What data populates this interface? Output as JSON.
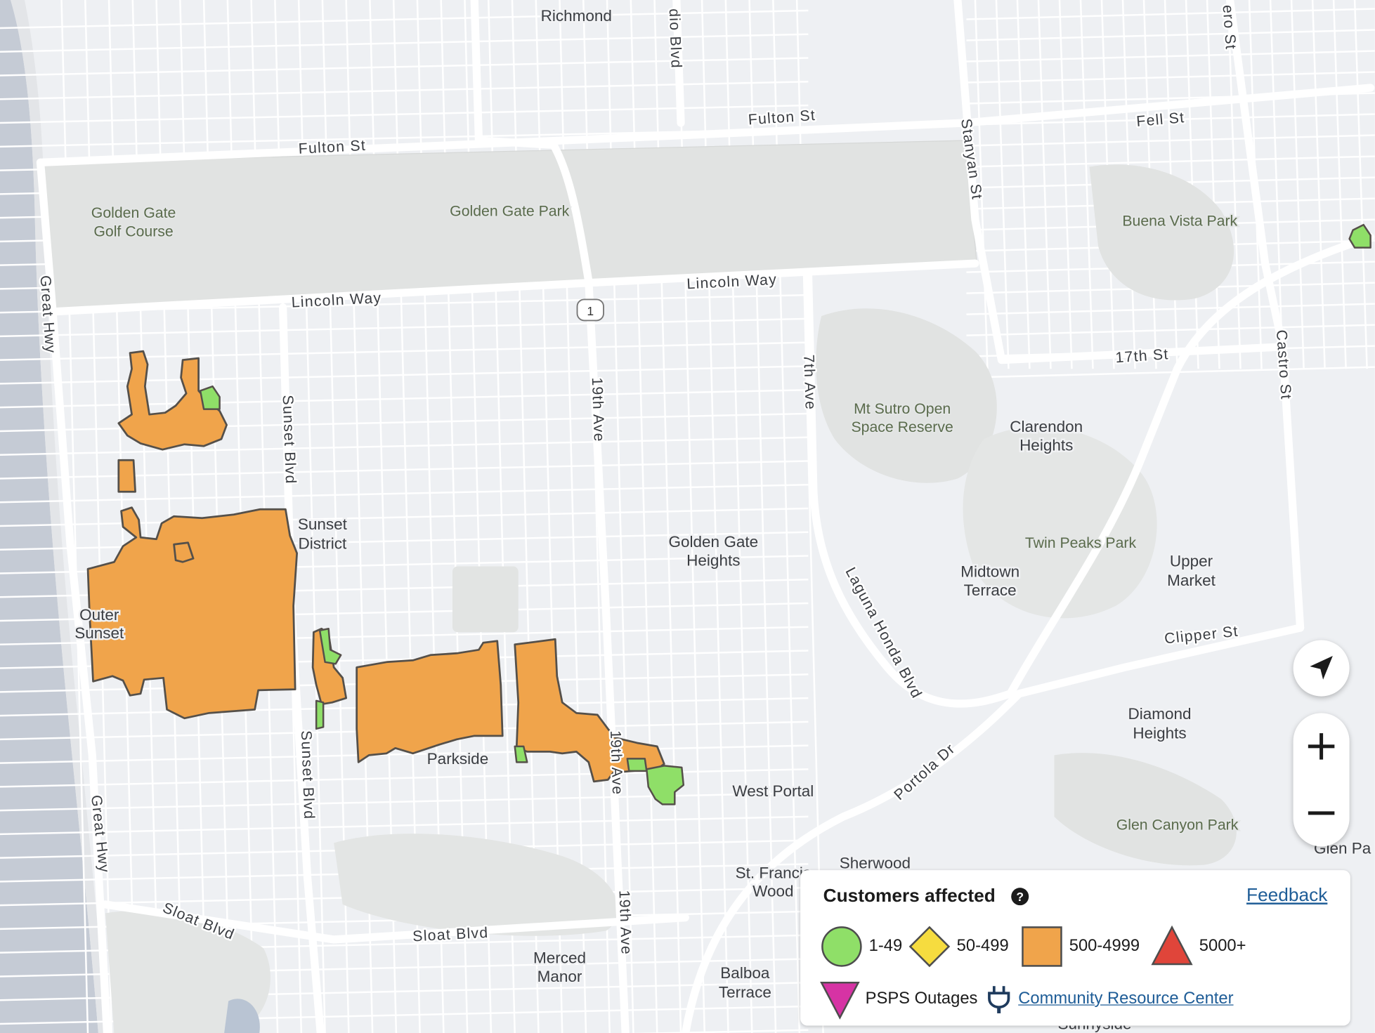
{
  "map": {
    "neighborhoods": {
      "richmond": "Richmond",
      "sunset_district": [
        "Sunset",
        "District"
      ],
      "outer_sunset": [
        "Outer",
        "Sunset"
      ],
      "parkside": "Parkside",
      "golden_gate_heights": [
        "Golden Gate",
        "Heights"
      ],
      "clarendon_heights": [
        "Clarendon",
        "Heights"
      ],
      "midtown_terrace": [
        "Midtown",
        "Terrace"
      ],
      "upper_market": [
        "Upper",
        "Market"
      ],
      "diamond_heights": [
        "Diamond",
        "Heights"
      ],
      "west_portal": "West Portal",
      "sherwood": "Sherwood",
      "st_francis_wood": [
        "St. Francis",
        "Wood"
      ],
      "merced_manor": [
        "Merced",
        "Manor"
      ],
      "balboa_terrace": [
        "Balboa",
        "Terrace"
      ],
      "glen_park": "Glen Pa",
      "sunnyside": "Sunnyside"
    },
    "parks": {
      "golden_gate_golf_course": [
        "Golden Gate",
        "Golf Course"
      ],
      "golden_gate_park": "Golden Gate Park",
      "buena_vista_park": "Buena Vista Park",
      "mt_sutro": [
        "Mt Sutro Open",
        "Space Reserve"
      ],
      "twin_peaks_park": "Twin Peaks Park",
      "glen_canyon_park": "Glen Canyon Park"
    },
    "streets": {
      "fulton_west": "Fulton St",
      "fulton_east": "Fulton St",
      "fell": "Fell St",
      "stanyan": "Stanyan St",
      "lincoln_west": "Lincoln Way",
      "lincoln_east": "Lincoln Way",
      "great_hwy_north": "Great Hwy",
      "great_hwy_south": "Great Hwy",
      "sunset_blvd_north": "Sunset Blvd",
      "sunset_blvd_south": "Sunset Blvd",
      "nineteenth_north": "19th Ave",
      "nineteenth_mid": "19th Ave",
      "nineteenth_south": "19th Ave",
      "seventh_ave": "7th Ave",
      "laguna_honda": "Laguna Honda Blvd",
      "seventeenth": "17th St",
      "castro": "Castro St",
      "clipper": "Clipper St",
      "portola": "Portola Dr",
      "sloat_west": "Sloat Blvd",
      "sloat_east": "Sloat Blvd",
      "radio_blvd": "dio Blvd",
      "guerrero": "ero St",
      "highway_shield": "1"
    }
  },
  "controls": {
    "locate_icon": "navigation-arrow-icon",
    "zoom_in": "+",
    "zoom_out": "−"
  },
  "legend": {
    "title": "Customers affected",
    "help_icon": "?",
    "feedback": "Feedback",
    "items": [
      {
        "label": "1-49",
        "shape": "circle",
        "color": "#8fdf68"
      },
      {
        "label": "50-499",
        "shape": "diamond",
        "color": "#f6dc3f"
      },
      {
        "label": "500-4999",
        "shape": "square",
        "color": "#f0a44b"
      },
      {
        "label": "5000+",
        "shape": "triangle",
        "color": "#e0453a"
      }
    ],
    "psps": {
      "label": "PSPS Outages",
      "color": "#d633a4"
    },
    "community": {
      "label": "Community Resource Center",
      "icon": "plug-icon"
    }
  }
}
